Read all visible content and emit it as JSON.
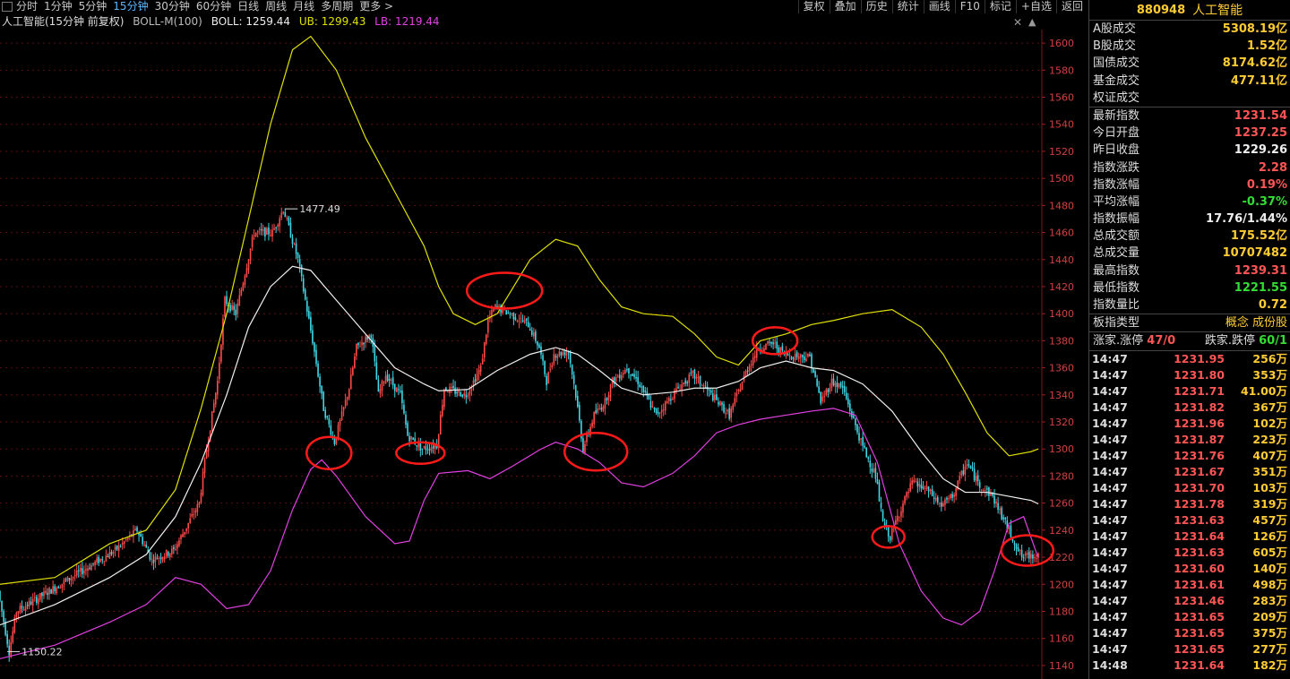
{
  "toolbar": {
    "periods": [
      "分时",
      "1分钟",
      "5分钟",
      "15分钟",
      "30分钟",
      "60分钟",
      "日线",
      "周线",
      "月线",
      "多周期",
      "更多 >"
    ],
    "active_period": "15分钟",
    "right_tools": [
      "复权",
      "叠加",
      "历史",
      "统计",
      "画线",
      "F10",
      "标记",
      "+自选",
      "返回"
    ]
  },
  "legend": {
    "name": "人工智能(15分钟 前复权)",
    "indicator": "BOLL-M(100)",
    "boll": "BOLL: 1259.44",
    "ub": "UB: 1299.43",
    "lb": "LB: 1219.44"
  },
  "chart_data": {
    "type": "line",
    "chart_kind": "candlestick_with_bollinger",
    "ylim": [
      1130,
      1610
    ],
    "yticks": [
      1140,
      1160,
      1180,
      1200,
      1220,
      1240,
      1260,
      1280,
      1300,
      1320,
      1340,
      1360,
      1380,
      1400,
      1420,
      1440,
      1460,
      1480,
      1500,
      1520,
      1540,
      1560,
      1580,
      1600
    ],
    "grid": true,
    "annotations": [
      {
        "label": "1477.49",
        "x": 78,
        "y": 1477.49
      },
      {
        "label": "1150.22",
        "x": 2,
        "y": 1150.22
      }
    ],
    "price_path": [
      [
        0,
        1195
      ],
      [
        3,
        1150.22
      ],
      [
        5,
        1180
      ],
      [
        20,
        1205
      ],
      [
        32,
        1225
      ],
      [
        38,
        1240
      ],
      [
        42,
        1218
      ],
      [
        48,
        1225
      ],
      [
        55,
        1260
      ],
      [
        57,
        1300
      ],
      [
        60,
        1350
      ],
      [
        62,
        1410
      ],
      [
        65,
        1400
      ],
      [
        70,
        1460
      ],
      [
        75,
        1460
      ],
      [
        78,
        1477.49
      ],
      [
        82,
        1440
      ],
      [
        86,
        1380
      ],
      [
        89,
        1330
      ],
      [
        92,
        1305
      ],
      [
        96,
        1345
      ],
      [
        98,
        1375
      ],
      [
        102,
        1385
      ],
      [
        104,
        1340
      ],
      [
        106,
        1355
      ],
      [
        110,
        1340
      ],
      [
        112,
        1310
      ],
      [
        116,
        1300
      ],
      [
        120,
        1303
      ],
      [
        122,
        1345
      ],
      [
        128,
        1340
      ],
      [
        132,
        1360
      ],
      [
        134,
        1395
      ],
      [
        136,
        1405
      ],
      [
        140,
        1400
      ],
      [
        145,
        1392
      ],
      [
        148,
        1375
      ],
      [
        150,
        1350
      ],
      [
        152,
        1370
      ],
      [
        156,
        1372
      ],
      [
        158,
        1340
      ],
      [
        160,
        1300
      ],
      [
        163,
        1325
      ],
      [
        166,
        1335
      ],
      [
        168,
        1350
      ],
      [
        172,
        1360
      ],
      [
        175,
        1350
      ],
      [
        180,
        1325
      ],
      [
        186,
        1345
      ],
      [
        190,
        1355
      ],
      [
        195,
        1340
      ],
      [
        200,
        1325
      ],
      [
        205,
        1360
      ],
      [
        208,
        1375
      ],
      [
        212,
        1378
      ],
      [
        215,
        1370
      ],
      [
        222,
        1368
      ],
      [
        225,
        1335
      ],
      [
        228,
        1350
      ],
      [
        231,
        1345
      ],
      [
        236,
        1305
      ],
      [
        240,
        1280
      ],
      [
        242,
        1245
      ],
      [
        244,
        1235
      ],
      [
        246,
        1250
      ],
      [
        250,
        1275
      ],
      [
        254,
        1270
      ],
      [
        258,
        1258
      ],
      [
        261,
        1265
      ],
      [
        265,
        1290
      ],
      [
        268,
        1275
      ],
      [
        272,
        1265
      ],
      [
        275,
        1248
      ],
      [
        280,
        1220
      ],
      [
        284,
        1222
      ]
    ],
    "series": [
      {
        "name": "UB",
        "color": "#e0e000",
        "values": [
          [
            0,
            1200
          ],
          [
            15,
            1205
          ],
          [
            30,
            1230
          ],
          [
            40,
            1240
          ],
          [
            48,
            1270
          ],
          [
            55,
            1330
          ],
          [
            62,
            1400
          ],
          [
            68,
            1470
          ],
          [
            74,
            1540
          ],
          [
            80,
            1595
          ],
          [
            85,
            1605
          ],
          [
            92,
            1580
          ],
          [
            100,
            1530
          ],
          [
            108,
            1490
          ],
          [
            116,
            1450
          ],
          [
            120,
            1420
          ],
          [
            124,
            1400
          ],
          [
            130,
            1392
          ],
          [
            136,
            1400
          ],
          [
            145,
            1440
          ],
          [
            152,
            1455
          ],
          [
            158,
            1450
          ],
          [
            164,
            1425
          ],
          [
            170,
            1405
          ],
          [
            176,
            1400
          ],
          [
            184,
            1398
          ],
          [
            190,
            1385
          ],
          [
            196,
            1368
          ],
          [
            202,
            1362
          ],
          [
            208,
            1380
          ],
          [
            215,
            1385
          ],
          [
            222,
            1392
          ],
          [
            228,
            1395
          ],
          [
            236,
            1400
          ],
          [
            244,
            1403
          ],
          [
            252,
            1390
          ],
          [
            258,
            1370
          ],
          [
            264,
            1342
          ],
          [
            270,
            1312
          ],
          [
            276,
            1295
          ],
          [
            282,
            1298
          ],
          [
            284,
            1300
          ]
        ]
      },
      {
        "name": "BOLL",
        "color": "#f0f0f0",
        "values": [
          [
            0,
            1170
          ],
          [
            15,
            1185
          ],
          [
            30,
            1205
          ],
          [
            40,
            1222
          ],
          [
            48,
            1250
          ],
          [
            55,
            1290
          ],
          [
            62,
            1340
          ],
          [
            68,
            1390
          ],
          [
            74,
            1420
          ],
          [
            80,
            1435
          ],
          [
            85,
            1432
          ],
          [
            92,
            1410
          ],
          [
            100,
            1385
          ],
          [
            108,
            1360
          ],
          [
            116,
            1348
          ],
          [
            120,
            1343
          ],
          [
            128,
            1344
          ],
          [
            136,
            1358
          ],
          [
            145,
            1370
          ],
          [
            152,
            1375
          ],
          [
            158,
            1370
          ],
          [
            164,
            1358
          ],
          [
            170,
            1345
          ],
          [
            176,
            1340
          ],
          [
            184,
            1342
          ],
          [
            190,
            1345
          ],
          [
            196,
            1345
          ],
          [
            202,
            1350
          ],
          [
            208,
            1360
          ],
          [
            215,
            1365
          ],
          [
            222,
            1360
          ],
          [
            228,
            1358
          ],
          [
            236,
            1348
          ],
          [
            244,
            1328
          ],
          [
            252,
            1298
          ],
          [
            258,
            1278
          ],
          [
            264,
            1268
          ],
          [
            270,
            1268
          ],
          [
            276,
            1265
          ],
          [
            282,
            1262
          ],
          [
            284,
            1259.44
          ]
        ]
      },
      {
        "name": "LB",
        "color": "#e040e0",
        "values": [
          [
            0,
            1145
          ],
          [
            15,
            1155
          ],
          [
            30,
            1172
          ],
          [
            40,
            1185
          ],
          [
            48,
            1205
          ],
          [
            55,
            1200
          ],
          [
            62,
            1182
          ],
          [
            68,
            1185
          ],
          [
            74,
            1210
          ],
          [
            80,
            1255
          ],
          [
            85,
            1285
          ],
          [
            88,
            1292
          ],
          [
            92,
            1280
          ],
          [
            100,
            1250
          ],
          [
            108,
            1230
          ],
          [
            112,
            1232
          ],
          [
            116,
            1262
          ],
          [
            120,
            1282
          ],
          [
            128,
            1284
          ],
          [
            134,
            1278
          ],
          [
            140,
            1287
          ],
          [
            148,
            1300
          ],
          [
            152,
            1305
          ],
          [
            158,
            1300
          ],
          [
            164,
            1290
          ],
          [
            170,
            1275
          ],
          [
            176,
            1272
          ],
          [
            184,
            1282
          ],
          [
            190,
            1295
          ],
          [
            196,
            1312
          ],
          [
            202,
            1318
          ],
          [
            208,
            1322
          ],
          [
            215,
            1325
          ],
          [
            222,
            1328
          ],
          [
            228,
            1330
          ],
          [
            234,
            1325
          ],
          [
            240,
            1290
          ],
          [
            246,
            1230
          ],
          [
            252,
            1195
          ],
          [
            258,
            1175
          ],
          [
            263,
            1170
          ],
          [
            268,
            1180
          ],
          [
            272,
            1210
          ],
          [
            276,
            1245
          ],
          [
            280,
            1250
          ],
          [
            284,
            1219.44
          ]
        ]
      }
    ]
  },
  "panel": {
    "code": "880948",
    "title": "人工智能",
    "stats": [
      {
        "k": "A股成交",
        "v": "5308.19亿",
        "c": "#ffcc33"
      },
      {
        "k": "B股成交",
        "v": "1.52亿",
        "c": "#ffcc33"
      },
      {
        "k": "国债成交",
        "v": "8174.62亿",
        "c": "#ffcc33"
      },
      {
        "k": "基金成交",
        "v": "477.11亿",
        "c": "#ffcc33"
      },
      {
        "k": "权证成交",
        "v": "",
        "c": "#ffcc33"
      }
    ],
    "index": [
      {
        "k": "最新指数",
        "v": "1231.54",
        "c": "#ff5555"
      },
      {
        "k": "今日开盘",
        "v": "1237.25",
        "c": "#ff5555"
      },
      {
        "k": "昨日收盘",
        "v": "1229.26",
        "c": "#eeeeee"
      },
      {
        "k": "指数涨跌",
        "v": "2.28",
        "c": "#ff5555"
      },
      {
        "k": "指数涨幅",
        "v": "0.19%",
        "c": "#ff5555"
      },
      {
        "k": "平均涨幅",
        "v": "-0.37%",
        "c": "#33dd33"
      },
      {
        "k": "指数振幅",
        "v": "17.76/1.44%",
        "c": "#eeeeee"
      },
      {
        "k": "总成交额",
        "v": "175.52亿",
        "c": "#ffcc33"
      },
      {
        "k": "总成交量",
        "v": "10707482",
        "c": "#ffcc33"
      },
      {
        "k": "最高指数",
        "v": "1239.31",
        "c": "#ff5555"
      },
      {
        "k": "最低指数",
        "v": "1221.55",
        "c": "#33dd33"
      },
      {
        "k": "指数量比",
        "v": "0.72",
        "c": "#ffcc33"
      }
    ],
    "board_type_label": "板指类型",
    "board_type_value": "概念 成份股",
    "up_label": "涨家.涨停",
    "up_value": "47/0",
    "down_label": "跌家.跌停",
    "down_value": "60/1",
    "ticks": [
      [
        "14:47",
        "1231.95",
        "256万"
      ],
      [
        "14:47",
        "1231.80",
        "353万"
      ],
      [
        "14:47",
        "1231.71",
        "41.00万"
      ],
      [
        "14:47",
        "1231.82",
        "367万"
      ],
      [
        "14:47",
        "1231.96",
        "102万"
      ],
      [
        "14:47",
        "1231.87",
        "223万"
      ],
      [
        "14:47",
        "1231.76",
        "407万"
      ],
      [
        "14:47",
        "1231.67",
        "351万"
      ],
      [
        "14:47",
        "1231.70",
        "103万"
      ],
      [
        "14:47",
        "1231.78",
        "319万"
      ],
      [
        "14:47",
        "1231.63",
        "457万"
      ],
      [
        "14:47",
        "1231.64",
        "126万"
      ],
      [
        "14:47",
        "1231.63",
        "605万"
      ],
      [
        "14:47",
        "1231.60",
        "140万"
      ],
      [
        "14:47",
        "1231.61",
        "498万"
      ],
      [
        "14:47",
        "1231.46",
        "283万"
      ],
      [
        "14:47",
        "1231.65",
        "209万"
      ],
      [
        "14:47",
        "1231.65",
        "375万"
      ],
      [
        "14:47",
        "1231.65",
        "277万"
      ],
      [
        "14:48",
        "1231.64",
        "182万"
      ]
    ]
  }
}
